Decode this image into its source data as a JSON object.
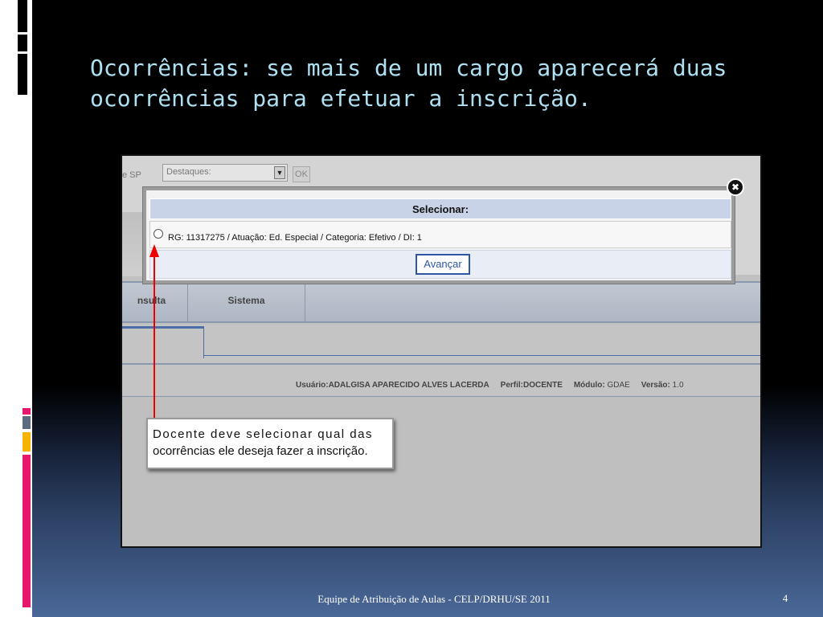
{
  "slide": {
    "title_line1": "Ocorrências: se mais de um cargo aparecerá duas",
    "title_line2": "ocorrências para efetuar a inscrição.",
    "footer": "Equipe de Atribuição de Aulas - CELP/DRHU/SE  2011",
    "page_number": "4"
  },
  "screenshot": {
    "header_fragment": "e SP",
    "destaques_placeholder": "Destaques:",
    "ok_label": "OK",
    "nav": {
      "consulta": "nsulta",
      "sistema": "Sistema"
    },
    "userbar": {
      "usuario_label": "Usuário:",
      "usuario_value": "ADALGISA APARECIDO ALVES LACERDA",
      "perfil_label": "Perfil:",
      "perfil_value": "DOCENTE",
      "modulo_label": "Módulo:",
      "modulo_value": "GDAE",
      "versao_label": "Versão:",
      "versao_value": "1.0"
    }
  },
  "modal": {
    "close_glyph": "✖",
    "header": "Selecionar:",
    "option_text": "RG: 11317275 / Atuação: Ed. Especial / Categoria: Efetivo / DI: 1",
    "advance_label": "Avançar"
  },
  "annotation": {
    "line1": "Docente deve selecionar qual das",
    "line2": "ocorrências ele deseja fazer a inscrição.",
    "color": "#e00000"
  }
}
